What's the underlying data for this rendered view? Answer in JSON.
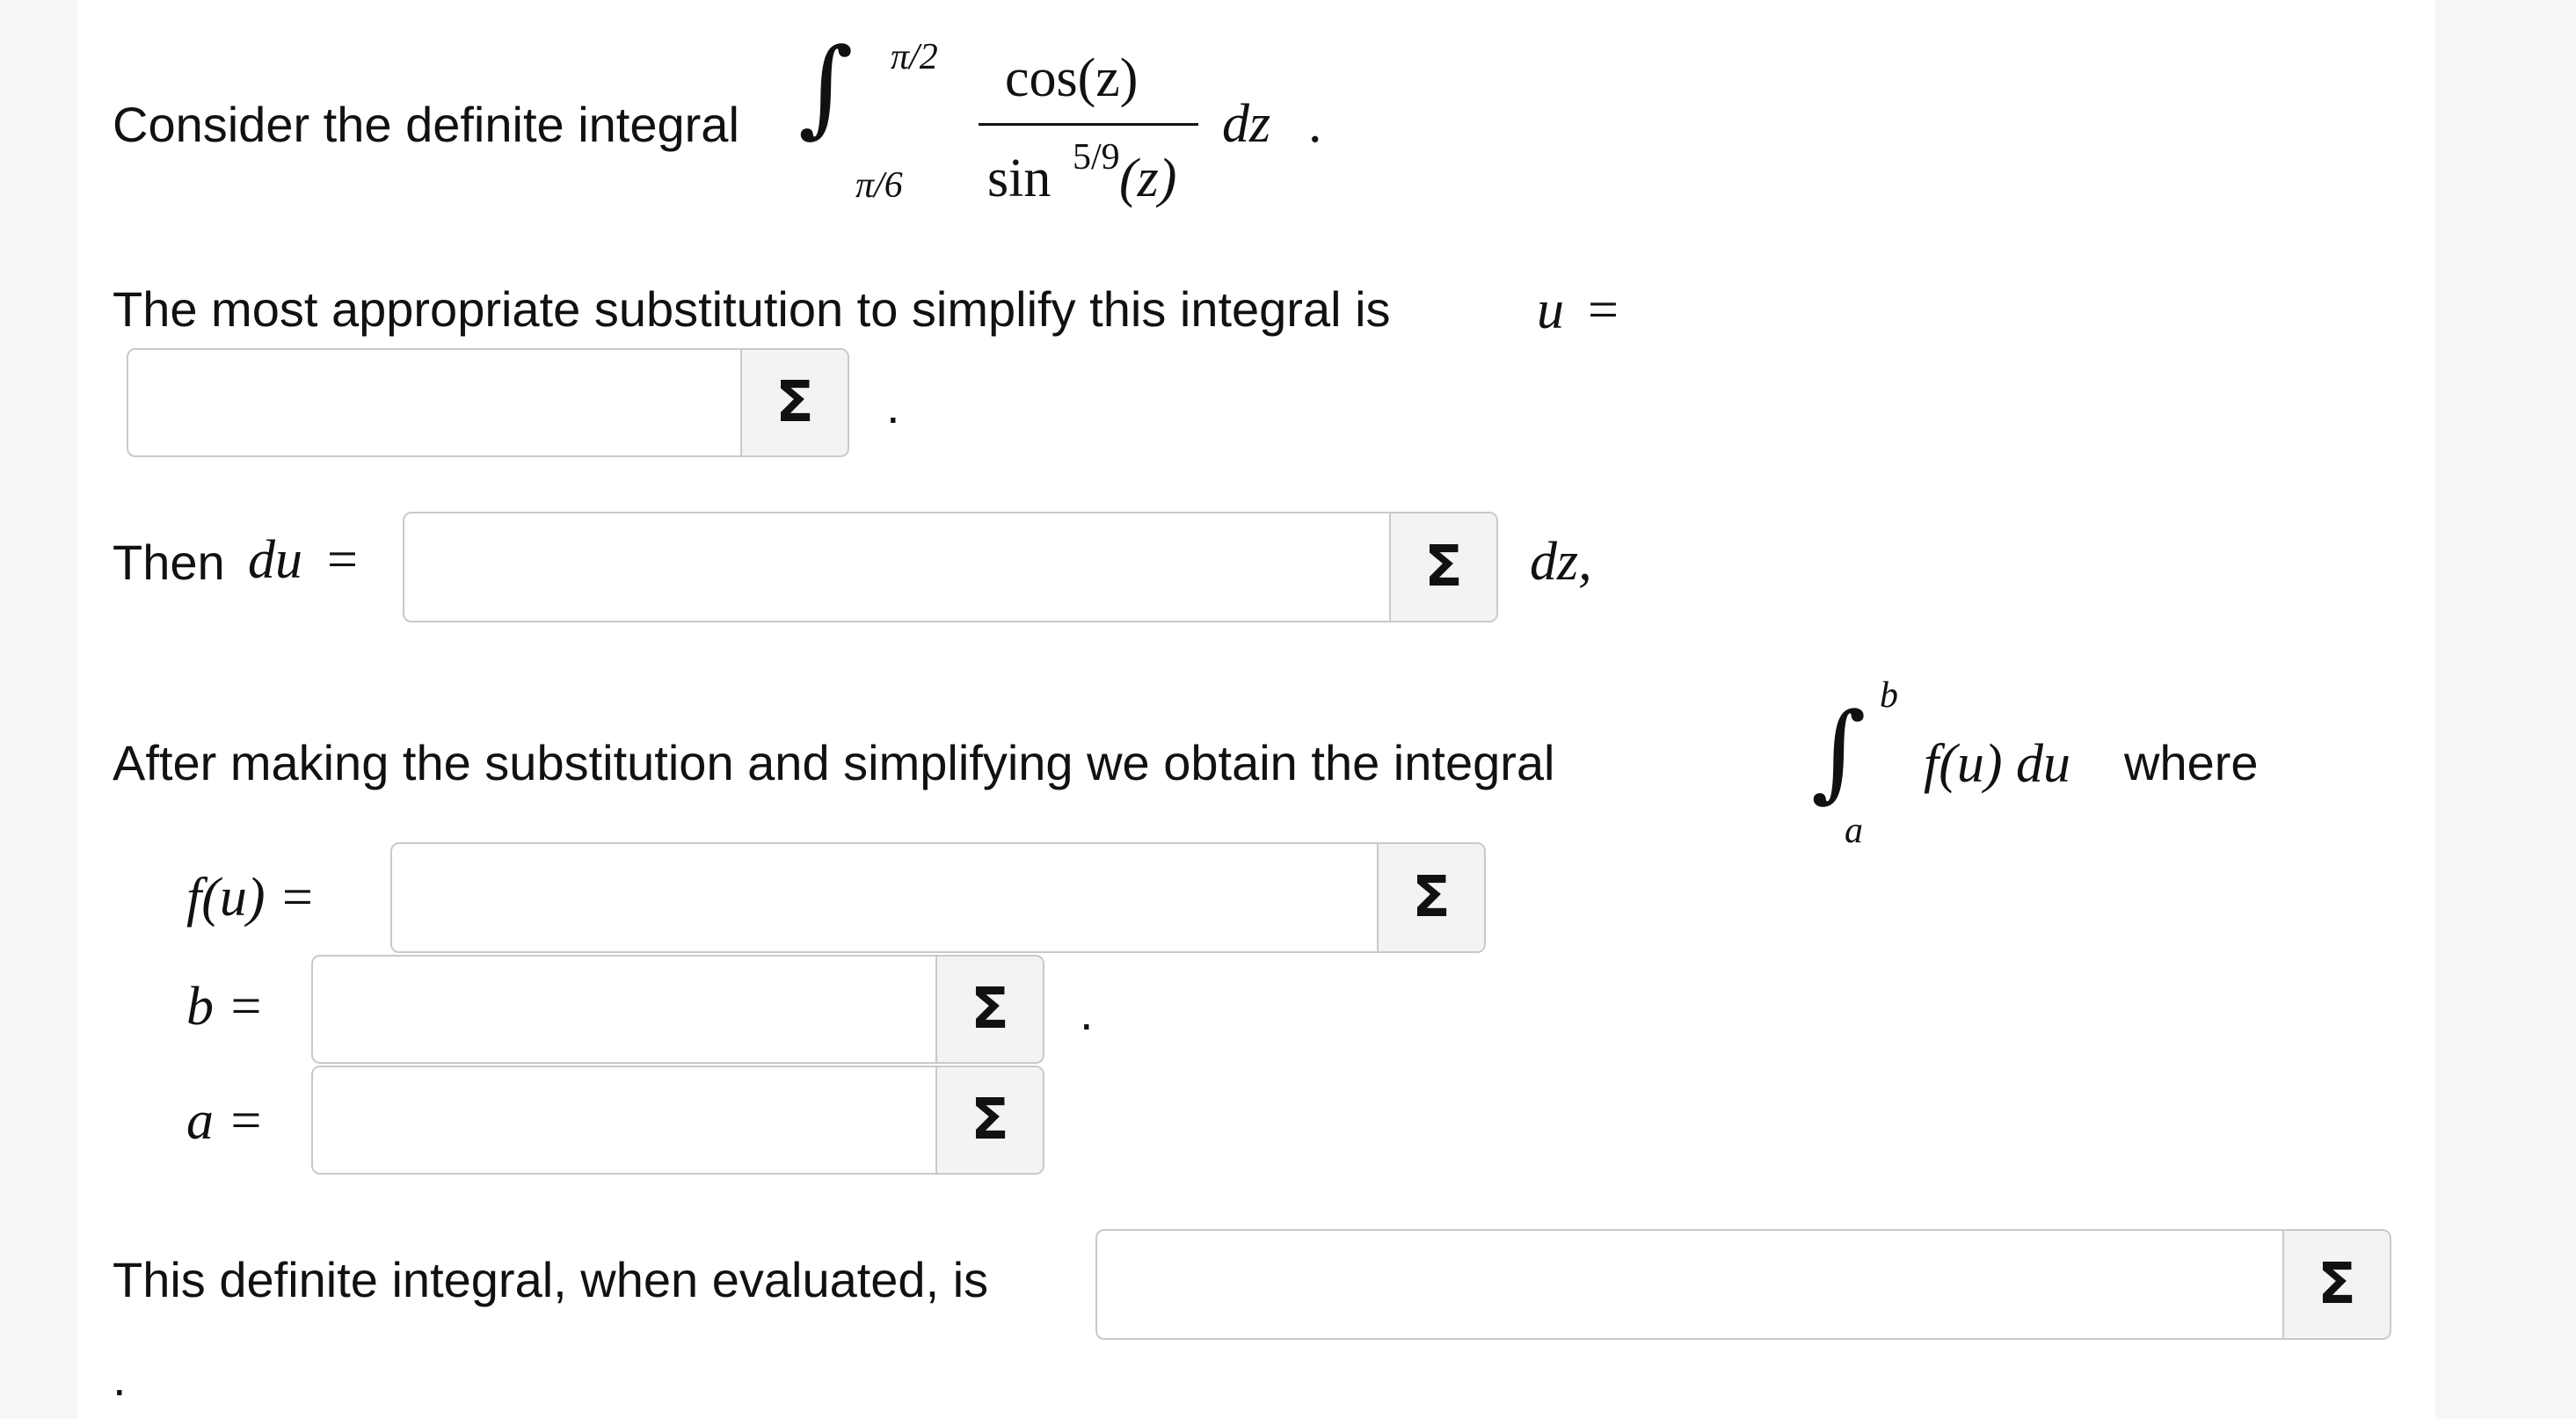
{
  "question": {
    "intro_text": "Consider the definite integral",
    "integral": {
      "upper": "π/2",
      "lower": "π/6",
      "numerator": "cos(z)",
      "denominator_base": "sin",
      "denominator_power": "5/9",
      "denominator_arg": "(z)",
      "differential": "dz",
      "trailing": "."
    },
    "substitution": {
      "text": "The most appropriate substitution to simplify this integral is",
      "var": "u",
      "equals": "=",
      "trailing": "."
    },
    "then": {
      "text": "Then",
      "du": "du",
      "equals": "=",
      "dz": "dz,"
    },
    "after": {
      "text": "After making the substitution and simplifying we obtain the integral",
      "upper": "b",
      "lower": "a",
      "integrand": "f(u) du",
      "where": "where"
    },
    "fu_label": "f(u) =",
    "b_label": "b =",
    "b_trailing": ".",
    "a_label": "a =",
    "evaluated_text": "This definite integral, when evaluated, is",
    "final_period": "."
  },
  "inputs": {
    "u_value": "",
    "du_value": "",
    "fu_value": "",
    "b_value": "",
    "a_value": "",
    "result_value": ""
  },
  "icons": {
    "sigma_glyph": "Σ",
    "integral_glyph": "∫"
  }
}
